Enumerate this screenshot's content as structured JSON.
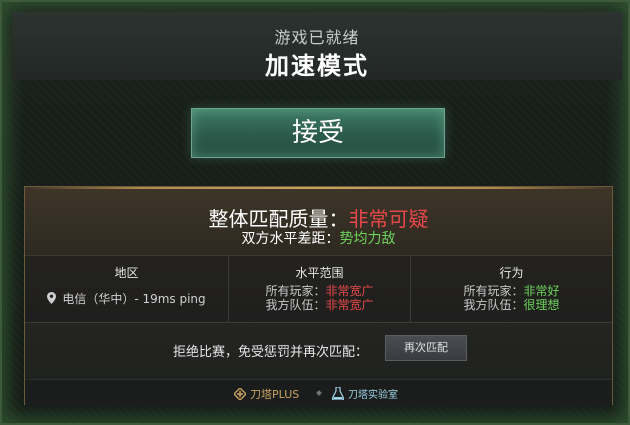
{
  "header": {
    "subtitle": "游戏已就绪",
    "title": "加速模式"
  },
  "accept_button": {
    "label": "接受"
  },
  "match_quality": {
    "label": "整体匹配质量：",
    "value": "非常可疑",
    "diff_label": "双方水平差距：",
    "diff_value": "势均力敌"
  },
  "columns": {
    "region": {
      "header": "地区",
      "value": "电信（华中）- 19ms ping",
      "icon": "location-pin-icon"
    },
    "skill": {
      "header": "水平范围",
      "all_label": "所有玩家：",
      "all_value": "非常宽广",
      "team_label": "我方队伍：",
      "team_value": "非常宽广"
    },
    "behavior": {
      "header": "行为",
      "all_label": "所有玩家：",
      "all_value": "非常好",
      "team_label": "我方队伍：",
      "team_value": "很理想"
    }
  },
  "reject": {
    "text": "拒绝比赛，免受惩罚并再次匹配：",
    "button_label": "再次匹配"
  },
  "footer": {
    "brand1": "刀塔PLUS",
    "brand1_icon": "dota-plus-icon",
    "brand2": "刀塔实验室",
    "brand2_icon": "flask-icon"
  },
  "colors": {
    "accent_red": "#e8484a",
    "accent_green": "#6ed35c",
    "accept_green": "#2b5a4b",
    "gold": "#c9a461"
  }
}
